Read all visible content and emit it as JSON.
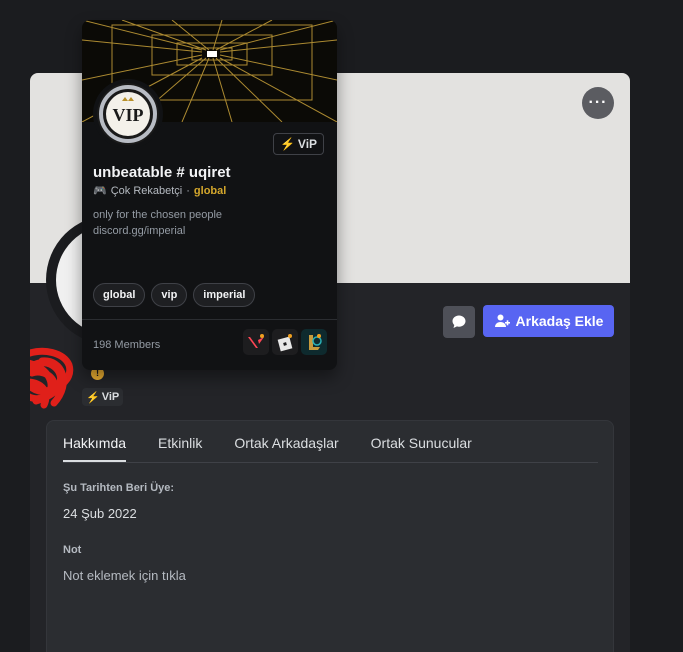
{
  "profile": {
    "more_label": "···",
    "add_friend_label": "Arkadaş Ekle",
    "vip_badge": "ViP",
    "warning_glyph": "!"
  },
  "tabs": [
    "Hakkımda",
    "Etkinlik",
    "Ortak Arkadaşlar",
    "Ortak Sunucular"
  ],
  "about": {
    "member_since_label": "Şu Tarihten Beri Üye:",
    "member_since_value": "24 Şub 2022",
    "note_label": "Not",
    "note_placeholder": "Not eklemek için tıkla"
  },
  "server": {
    "name": "unbeatable # uqiret",
    "vip_tag": "ViP",
    "activity": "Çok Rekabetçi",
    "separator": "·",
    "tag": "global",
    "description_line1": "only for the chosen people",
    "description_line2": "discord.gg/imperial",
    "tags": [
      "global",
      "vip",
      "imperial"
    ],
    "member_count": "198 Members"
  },
  "colors": {
    "accent": "#5865f2",
    "background": "#1b1c1f",
    "banner": "#e3e2e0",
    "gold": "#d4a72c"
  },
  "icons": {
    "more": "more-horizontal-icon",
    "message": "chat-bubble-icon",
    "add_friend": "add-person-icon",
    "bolt": "lightning-icon",
    "activity": "gamepad-icon"
  }
}
